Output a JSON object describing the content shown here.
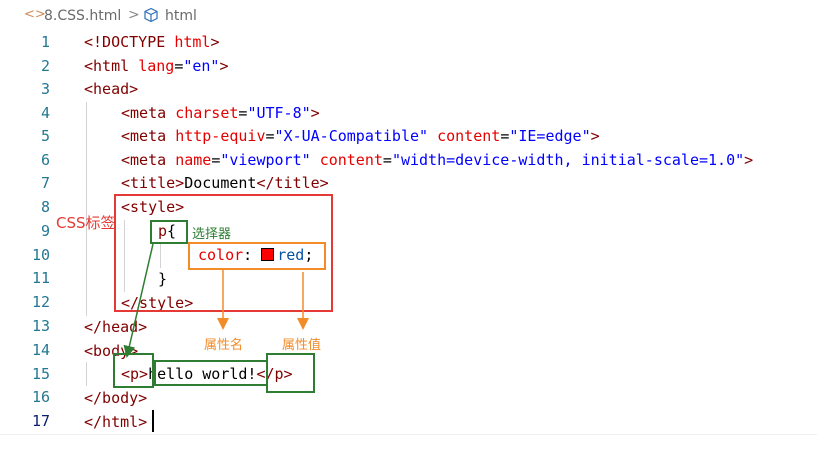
{
  "tab": {
    "file_icon": "<>",
    "file_name": "8.CSS.html",
    "separator": ">",
    "symbol": "html"
  },
  "line_numbers": [
    "1",
    "2",
    "3",
    "4",
    "5",
    "6",
    "7",
    "8",
    "9",
    "10",
    "11",
    "12",
    "13",
    "14",
    "15",
    "16",
    "17"
  ],
  "code": {
    "l1_a": "<!DOCTYPE ",
    "l1_b": "html",
    "l1_c": ">",
    "l2_a": "<html ",
    "l2_b": "lang",
    "l2_c": "=",
    "l2_d": "\"en\"",
    "l2_e": ">",
    "l3": "<head>",
    "l4_a": "<meta ",
    "l4_b": "charset",
    "l4_c": "=",
    "l4_d": "\"UTF-8\"",
    "l4_e": ">",
    "l5_a": "<meta ",
    "l5_b": "http-equiv",
    "l5_c": "=",
    "l5_d": "\"X-UA-Compatible\"",
    "l5_e": " ",
    "l5_f": "content",
    "l5_g": "=",
    "l5_h": "\"IE=edge\"",
    "l5_i": ">",
    "l6_a": "<meta ",
    "l6_b": "name",
    "l6_c": "=",
    "l6_d": "\"viewport\"",
    "l6_e": " ",
    "l6_f": "content",
    "l6_g": "=",
    "l6_h": "\"width=device-width, initial-scale=1.0\"",
    "l6_i": ">",
    "l7_a": "<title>",
    "l7_b": "Document",
    "l7_c": "</title>",
    "l8": "<style>",
    "l9_a": "p",
    "l9_b": "{",
    "l10_a": "color",
    "l10_b": ": ",
    "l10_c": "red",
    "l10_d": ";",
    "l11": "}",
    "l12": "</style>",
    "l13": "</head>",
    "l14": "<body>",
    "l15_a": "<p>",
    "l15_b": "hello world!",
    "l15_c": "</p>",
    "l16": "</body>",
    "l17": "</html>"
  },
  "annotations": {
    "css_tag": "CSS标签",
    "selector": "选择器",
    "property_name": "属性名",
    "property_value": "属性值"
  },
  "colors": {
    "red_box": "#e53935",
    "green_box": "#2e7d32",
    "orange_box": "#f28c28",
    "swatch": "#ff0000"
  }
}
